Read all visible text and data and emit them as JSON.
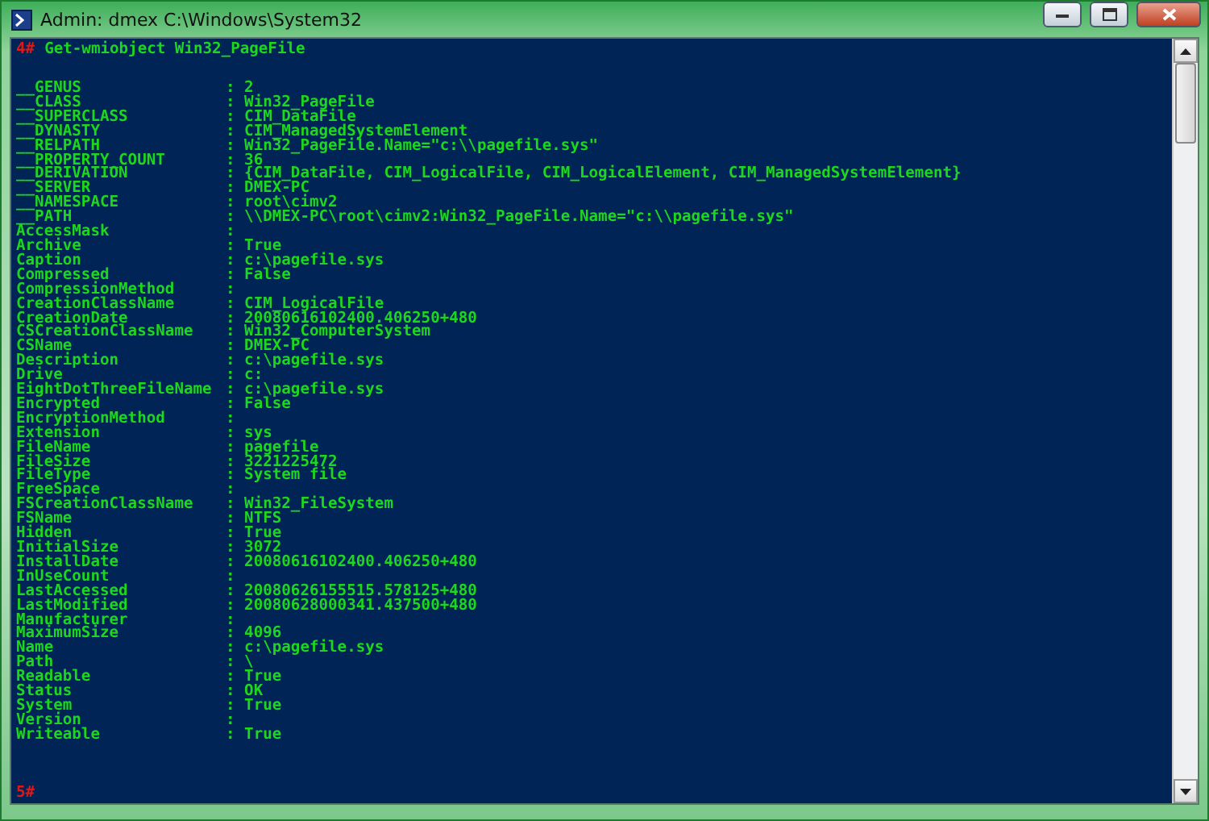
{
  "window": {
    "title": "Admin: dmex C:\\Windows\\System32"
  },
  "commands": [
    {
      "prompt": "4#",
      "command": "Get-wmiobject Win32_PageFile"
    }
  ],
  "properties": [
    {
      "name": "__GENUS",
      "value": ": 2"
    },
    {
      "name": "__CLASS",
      "value": ": Win32_PageFile"
    },
    {
      "name": "__SUPERCLASS",
      "value": ": CIM_DataFile"
    },
    {
      "name": "__DYNASTY",
      "value": ": CIM_ManagedSystemElement"
    },
    {
      "name": "__RELPATH",
      "value": ": Win32_PageFile.Name=\"c:\\\\pagefile.sys\""
    },
    {
      "name": "__PROPERTY_COUNT",
      "value": ": 36"
    },
    {
      "name": "__DERIVATION",
      "value": ": {CIM_DataFile, CIM_LogicalFile, CIM_LogicalElement, CIM_ManagedSystemElement}"
    },
    {
      "name": "__SERVER",
      "value": ": DMEX-PC"
    },
    {
      "name": "__NAMESPACE",
      "value": ": root\\cimv2"
    },
    {
      "name": "__PATH",
      "value": ": \\\\DMEX-PC\\root\\cimv2:Win32_PageFile.Name=\"c:\\\\pagefile.sys\""
    },
    {
      "name": "AccessMask",
      "value": ":"
    },
    {
      "name": "Archive",
      "value": ": True"
    },
    {
      "name": "Caption",
      "value": ": c:\\pagefile.sys"
    },
    {
      "name": "Compressed",
      "value": ": False"
    },
    {
      "name": "CompressionMethod",
      "value": ":"
    },
    {
      "name": "CreationClassName",
      "value": ": CIM_LogicalFile"
    },
    {
      "name": "CreationDate",
      "value": ": 20080616102400.406250+480"
    },
    {
      "name": "CSCreationClassName",
      "value": ": Win32_ComputerSystem"
    },
    {
      "name": "CSName",
      "value": ": DMEX-PC"
    },
    {
      "name": "Description",
      "value": ": c:\\pagefile.sys"
    },
    {
      "name": "Drive",
      "value": ": c:"
    },
    {
      "name": "EightDotThreeFileName",
      "value": ": c:\\pagefile.sys"
    },
    {
      "name": "Encrypted",
      "value": ": False"
    },
    {
      "name": "EncryptionMethod",
      "value": ":"
    },
    {
      "name": "Extension",
      "value": ": sys"
    },
    {
      "name": "FileName",
      "value": ": pagefile"
    },
    {
      "name": "FileSize",
      "value": ": 3221225472"
    },
    {
      "name": "FileType",
      "value": ": System file"
    },
    {
      "name": "FreeSpace",
      "value": ":"
    },
    {
      "name": "FSCreationClassName",
      "value": ": Win32_FileSystem"
    },
    {
      "name": "FSName",
      "value": ": NTFS"
    },
    {
      "name": "Hidden",
      "value": ": True"
    },
    {
      "name": "InitialSize",
      "value": ": 3072"
    },
    {
      "name": "InstallDate",
      "value": ": 20080616102400.406250+480"
    },
    {
      "name": "InUseCount",
      "value": ":"
    },
    {
      "name": "LastAccessed",
      "value": ": 20080626155515.578125+480"
    },
    {
      "name": "LastModified",
      "value": ": 20080628000341.437500+480"
    },
    {
      "name": "Manufacturer",
      "value": ":"
    },
    {
      "name": "MaximumSize",
      "value": ": 4096"
    },
    {
      "name": "Name",
      "value": ": c:\\pagefile.sys"
    },
    {
      "name": "Path",
      "value": ": \\"
    },
    {
      "name": "Readable",
      "value": ": True"
    },
    {
      "name": "Status",
      "value": ": OK"
    },
    {
      "name": "System",
      "value": ": True"
    },
    {
      "name": "Version",
      "value": ":"
    },
    {
      "name": "Writeable",
      "value": ": True"
    }
  ],
  "next_prompt": "5#"
}
